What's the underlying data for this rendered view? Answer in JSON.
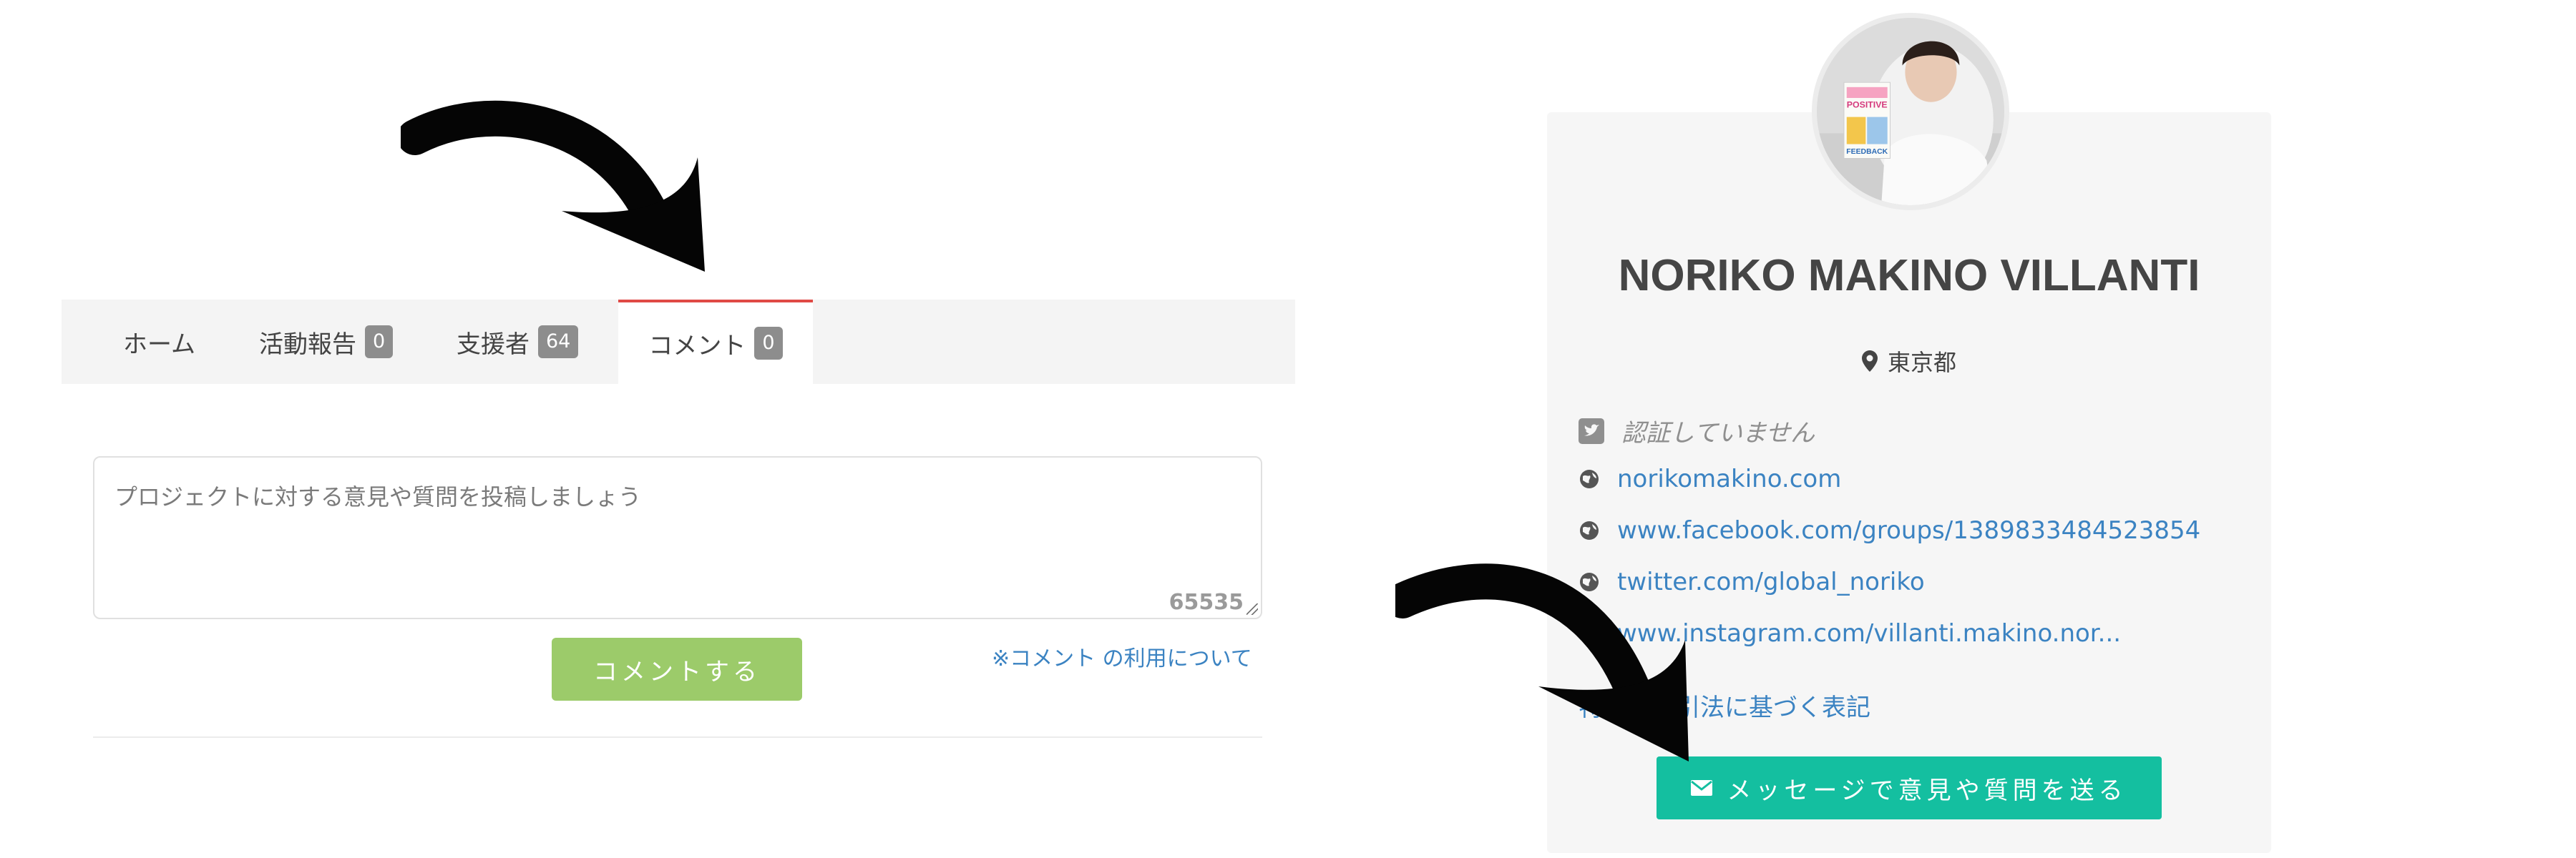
{
  "tabs": [
    {
      "label": "ホーム",
      "count": null,
      "active": false
    },
    {
      "label": "活動報告",
      "count": "0",
      "active": false
    },
    {
      "label": "支援者",
      "count": "64",
      "active": false
    },
    {
      "label": "コメント",
      "count": "0",
      "active": true
    }
  ],
  "comment_form": {
    "placeholder": "プロジェクトに対する意見や質問を投稿しましょう",
    "char_limit": "65535",
    "submit_label": "コメントする",
    "usage_link": "※コメント の利用について"
  },
  "profile": {
    "name": "NORIKO MAKINO VILLANTI",
    "location": "東京都",
    "twitter_status": "認証していません",
    "links": [
      "norikomakino.com",
      "www.facebook.com/groups/1389833484523854",
      "twitter.com/global_noriko",
      "www.instagram.com/villanti.makino.nor..."
    ],
    "law_link": "特定商取引法に基づく表記",
    "message_button": "メッセージで意見や質問を送る"
  },
  "avatar_image": {
    "book_title_line1": "POSITIVE",
    "book_title_line2": "FEEDBACK"
  },
  "colors": {
    "active_tab_accent": "#e04a46",
    "submit_button": "#9ccb6a",
    "message_button": "#14bfa0",
    "link": "#3b83c2"
  }
}
